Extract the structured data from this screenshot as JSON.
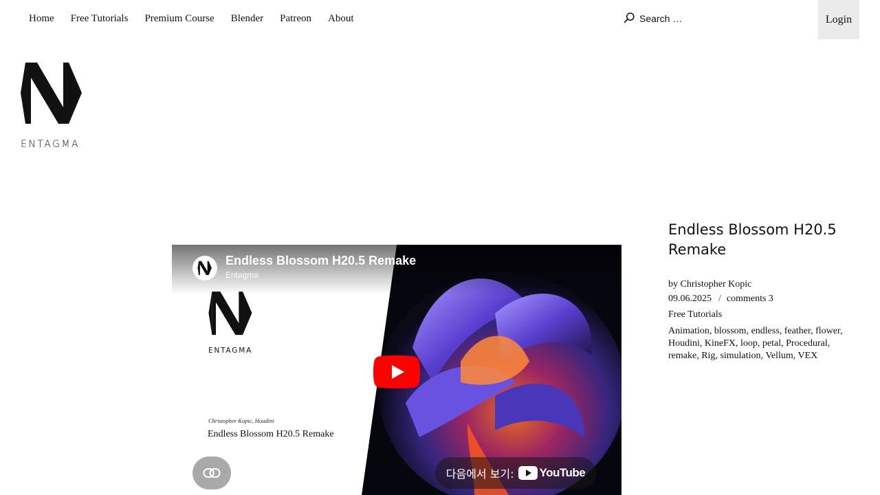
{
  "nav": {
    "items": [
      "Home",
      "Free Tutorials",
      "Premium Course",
      "Blender",
      "Patreon",
      "About"
    ]
  },
  "search": {
    "placeholder": "Search …"
  },
  "login": {
    "label": "Login"
  },
  "logo": {
    "text": "ENTAGMA"
  },
  "video": {
    "title": "Endless Blossom H20.5 Remake",
    "channel": "Entagma",
    "thumb_logo_text": "ENTAGMA",
    "thumb_byline": "Christopher Kopic, Houdini",
    "thumb_caption": "Endless Blossom H20.5 Remake",
    "watch_on": "다음에서 보기:",
    "youtube_word": "YouTube"
  },
  "post": {
    "title": "Endless Blossom H20.5 Remake",
    "byline_prefix": "by",
    "author": "Christopher Kopic",
    "date": "09.06.2025",
    "separator": "/",
    "comments": "comments 3",
    "category": "Free Tutorials",
    "tags": [
      "Animation",
      "blossom",
      "endless",
      "feather",
      "flower",
      "Houdini",
      "KineFX",
      "loop",
      "petal",
      "Procedural",
      "remake",
      "Rig",
      "simulation",
      "Vellum",
      "VEX"
    ]
  }
}
